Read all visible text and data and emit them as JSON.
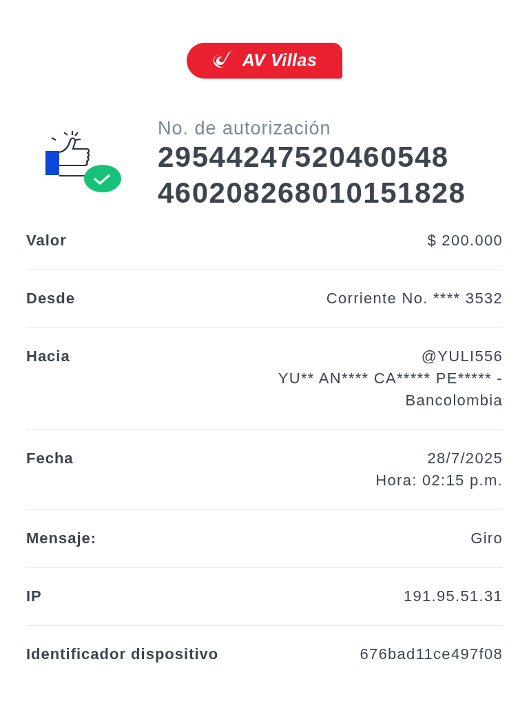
{
  "logo": {
    "text": "AV Villas"
  },
  "authorization": {
    "label": "No. de autorización",
    "lines": [
      "29544247520460548",
      "460208268010151828"
    ]
  },
  "details": [
    {
      "label": "Valor",
      "lines": [
        "$ 200.000"
      ]
    },
    {
      "label": "Desde",
      "lines": [
        "Corriente No. **** 3532"
      ]
    },
    {
      "label": "Hacia",
      "lines": [
        "@YULI556",
        "YU** AN**** CA***** PE***** -",
        "Bancolombia"
      ]
    },
    {
      "label": "Fecha",
      "lines": [
        "28/7/2025",
        "Hora: 02:15 p.m."
      ]
    },
    {
      "label": "Mensaje:",
      "lines": [
        "Giro"
      ]
    },
    {
      "label": "IP",
      "lines": [
        "191.95.51.31"
      ]
    },
    {
      "label": "Identificador dispositivo",
      "lines": [
        "676bad11ce497f08"
      ]
    }
  ]
}
